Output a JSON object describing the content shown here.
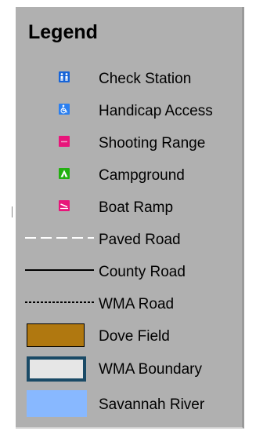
{
  "legend": {
    "title": "Legend",
    "items": [
      {
        "label": "Check Station",
        "icon": "check-station-icon",
        "color": "#1664d8"
      },
      {
        "label": "Handicap Access",
        "icon": "handicap-access-icon",
        "color": "#2a7ff0"
      },
      {
        "label": "Shooting Range",
        "icon": "shooting-range-icon",
        "color": "#e8157a"
      },
      {
        "label": "Campground",
        "icon": "campground-icon",
        "color": "#22b010"
      },
      {
        "label": "Boat Ramp",
        "icon": "boat-ramp-icon",
        "color": "#e8157a"
      },
      {
        "label": "Paved Road",
        "icon": "paved-road-line",
        "color": "#ffffff"
      },
      {
        "label": "County Road",
        "icon": "county-road-line",
        "color": "#000000"
      },
      {
        "label": "WMA Road",
        "icon": "wma-road-line",
        "color": "#000000"
      },
      {
        "label": "Dove Field",
        "icon": "dove-field-swatch",
        "color": "#b07810"
      },
      {
        "label": "WMA Boundary",
        "icon": "wma-boundary-swatch",
        "color": "#e6e6e6"
      },
      {
        "label": "Savannah River",
        "icon": "savannah-river-swatch",
        "color": "#88b8ff"
      }
    ]
  }
}
